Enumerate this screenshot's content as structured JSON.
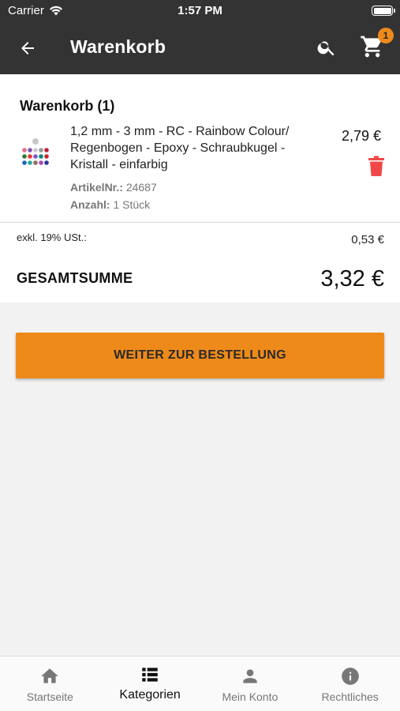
{
  "status_bar": {
    "carrier": "Carrier",
    "time": "1:57 PM"
  },
  "header": {
    "title": "Warenkorb",
    "cart_count": "1"
  },
  "cart": {
    "heading": "Warenkorb (1)",
    "item": {
      "name": "1,2 mm - 3 mm - RC - Rainbow Colour/ Regenbogen - Epoxy - Schraubkugel - Kristall - einfarbig",
      "price": "2,79 €",
      "article_label": "ArtikelNr.:",
      "article_number": "24687",
      "quantity_label": "Anzahl:",
      "quantity": "1 Stück"
    }
  },
  "totals": {
    "vat_label": "exkl. 19% USt.:",
    "vat_value": "0,53 €",
    "sum_label": "GESAMTSUMME",
    "sum_value": "3,32 €"
  },
  "order_button": "WEITER ZUR BESTELLUNG",
  "tabs": [
    {
      "label": "Startseite",
      "icon": "home-icon"
    },
    {
      "label": "Kategorien",
      "icon": "list-icon"
    },
    {
      "label": "Mein Konto",
      "icon": "person-icon"
    },
    {
      "label": "Rechtliches",
      "icon": "info-icon"
    }
  ],
  "colors": {
    "appbar": "#333333",
    "accent": "#ee8a1a",
    "delete": "#f04848"
  }
}
